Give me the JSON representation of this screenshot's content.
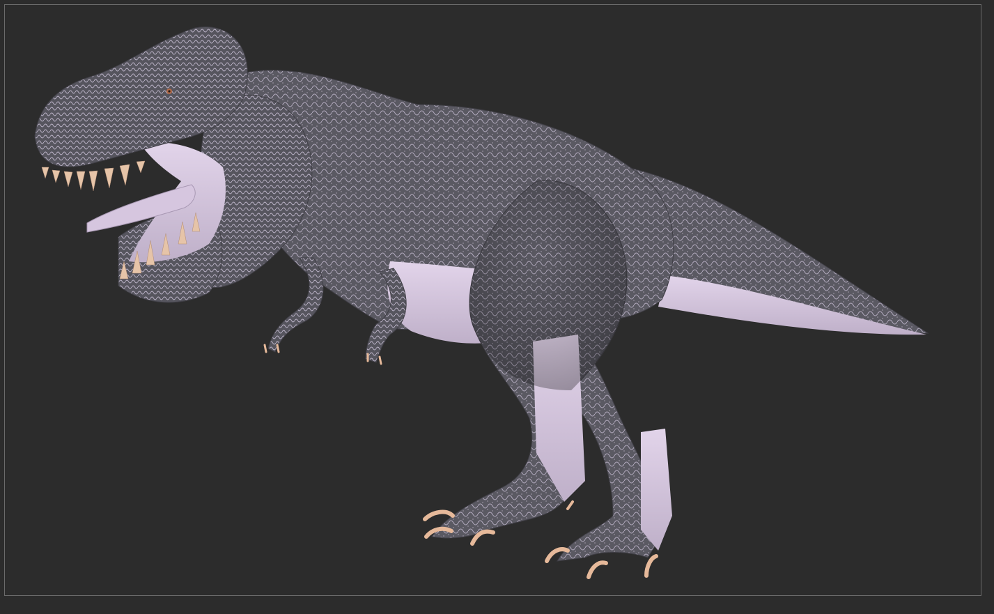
{
  "viewport": {
    "background_color": "#2c2c2c",
    "frame_color": "#6a6a6a"
  },
  "model": {
    "subject": "tyrannosaurus-rex-sculpt",
    "skin_color": "#5a5962",
    "scale_highlight_color": "#c9bfd6",
    "underbelly_color": "#d8c8e0",
    "claw_color": "#e6b99a"
  }
}
